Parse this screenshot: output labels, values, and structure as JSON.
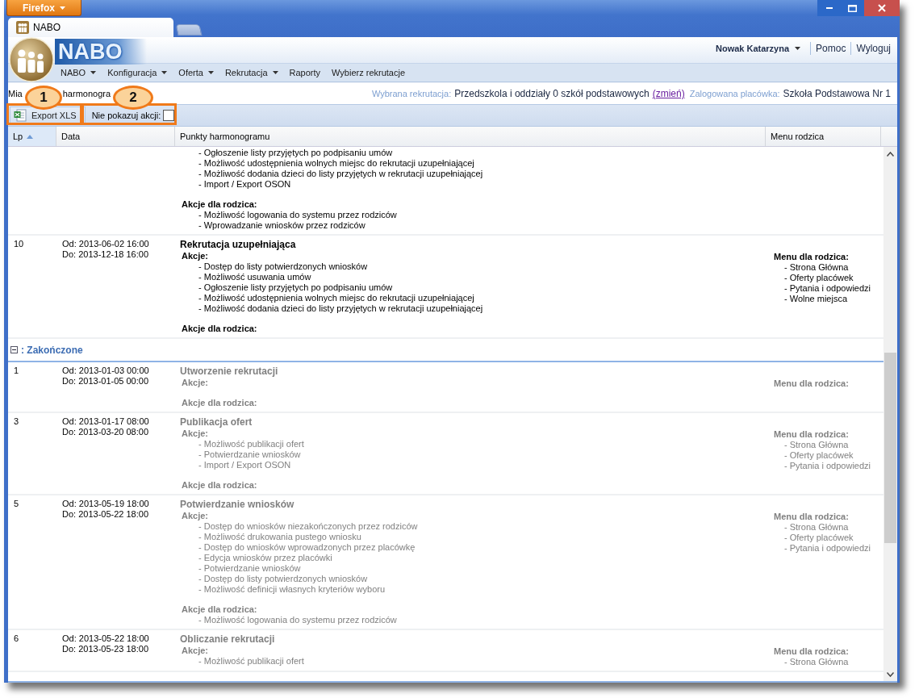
{
  "browser": {
    "menu_button": "Firefox",
    "tabs": [
      {
        "label": "NABO",
        "selected": true
      },
      {
        "selected": false
      }
    ]
  },
  "app": {
    "title": "NABO",
    "user": "Nowak Katarzyna",
    "links": [
      "Pomoc",
      "Wyloguj"
    ],
    "menu": [
      {
        "label": "NABO",
        "has_submenu": true
      },
      {
        "label": "Konfiguracja",
        "has_submenu": true
      },
      {
        "label": "Oferta",
        "has_submenu": true
      },
      {
        "label": "Rekrutacja",
        "has_submenu": true
      },
      {
        "label": "Raporty",
        "has_submenu": false
      },
      {
        "label": "Wybierz rekrutacje",
        "has_submenu": false
      }
    ]
  },
  "info": {
    "breadcrumb": [
      "Mia",
      "harmonogra"
    ],
    "recruitment_label": "Wybrana rekrutacja:",
    "recruitment": "Przedszkola i oddziały 0 szkół podstawowych",
    "change_link": "(zmień)",
    "facility_label": "Zalogowana placówka:",
    "facility": "Szkoła Podstawowa Nr 1"
  },
  "toolbar": {
    "export_button": "Export XLS",
    "hide_actions": {
      "label": "Nie pokazuj akcji:",
      "checked": false
    }
  },
  "callouts": [
    {
      "number": "1"
    },
    {
      "number": "2"
    }
  ],
  "table": {
    "columns": [
      {
        "label": "Lp",
        "sorted": true
      },
      {
        "label": "Data",
        "sorted": false
      },
      {
        "label": "Punkty harmonogramu",
        "sorted": false
      },
      {
        "label": "Menu rodzica",
        "sorted": false
      }
    ],
    "rows": [
      {
        "dimmed": false,
        "actions": [
          "- Ogłoszenie listy przyjętych po podpisaniu umów",
          "- Możliwość udostępnienia wolnych miejsc do rekrutacji uzupełniającej",
          "- Możliwość dodania dzieci do listy przyjętych w rekrutacji uzupełniającej",
          "- Import / Export OSON"
        ],
        "parent_actions_label": "Akcje dla rodzica:",
        "parent_actions": [
          "- Możliwość logowania do systemu przez rodziców",
          "- Wprowadzanie wniosków przez rodziców"
        ]
      },
      {
        "dimmed": false,
        "lp": "10",
        "date_from": "Od: 2013-06-02 16:00",
        "date_to": "Do: 2013-12-18 16:00",
        "title": "Rekrutacja uzupełniająca",
        "actions_label": "Akcje:",
        "actions": [
          "- Dostęp do listy potwierdzonych wniosków",
          "- Możliwość usuwania umów",
          "- Ogłoszenie listy przyjętych po podpisaniu umów",
          "- Możliwość udostępnienia wolnych miejsc do rekrutacji uzupełniającej",
          "- Możliwość dodania dzieci do listy przyjętych w rekrutacji uzupełniającej"
        ],
        "parent_actions_label": "Akcje dla rodzica:",
        "menu_label": "Menu dla rodzica:",
        "menu": [
          "- Strona Główna",
          "- Oferty placówek",
          "- Pytania i odpowiedzi",
          "- Wolne miejsca"
        ]
      }
    ],
    "groups": [
      {
        "label": ": Zakończone",
        "expanded": true,
        "rows": [
          {
            "dimmed": true,
            "lp": "1",
            "date_from": "Od: 2013-01-03 00:00",
            "date_to": "Do: 2013-01-05 00:00",
            "title": "Utworzenie rekrutacji",
            "actions_label": "Akcje:",
            "parent_actions_label": "Akcje dla rodzica:",
            "menu_label": "Menu dla rodzica:"
          },
          {
            "dimmed": true,
            "lp": "3",
            "date_from": "Od: 2013-01-17 08:00",
            "date_to": "Do: 2013-03-20 08:00",
            "title": "Publikacja ofert",
            "actions_label": "Akcje:",
            "actions": [
              "- Możliwość publikacji ofert",
              "- Potwierdzanie wniosków",
              "- Import / Export OSON"
            ],
            "parent_actions_label": "Akcje dla rodzica:",
            "menu_label": "Menu dla rodzica:",
            "menu": [
              "- Strona Główna",
              "- Oferty placówek",
              "- Pytania i odpowiedzi"
            ]
          },
          {
            "dimmed": true,
            "lp": "5",
            "date_from": "Od: 2013-05-19 18:00",
            "date_to": "Do: 2013-05-22 18:00",
            "title": "Potwierdzanie wniosków",
            "actions_label": "Akcje:",
            "actions": [
              "- Dostęp do wniosków niezakończonych przez rodziców",
              "- Możliwość drukowania pustego wniosku",
              "- Dostęp do wniosków wprowadzonych przez placówkę",
              "- Edycja wniosków przez placówki",
              "- Potwierdzanie wniosków",
              "- Dostęp do listy potwierdzonych wniosków",
              "- Możliwość definicji własnych kryteriów wyboru"
            ],
            "parent_actions_label": "Akcje dla rodzica:",
            "parent_actions": [
              "- Możliwość logowania do systemu przez rodziców"
            ],
            "menu_label": "Menu dla rodzica:",
            "menu": [
              "- Strona Główna",
              "- Oferty placówek",
              "- Pytania i odpowiedzi"
            ]
          },
          {
            "dimmed": true,
            "lp": "6",
            "date_from": "Od: 2013-05-22 18:00",
            "date_to": "Do: 2013-05-23 18:00",
            "title": "Obliczanie rekrutacji",
            "actions_label": "Akcje:",
            "actions": [
              "- Możliwość publikacji ofert"
            ],
            "menu_label": "Menu dla rodzica:",
            "menu": [
              "- Strona Główna"
            ]
          }
        ]
      }
    ]
  }
}
